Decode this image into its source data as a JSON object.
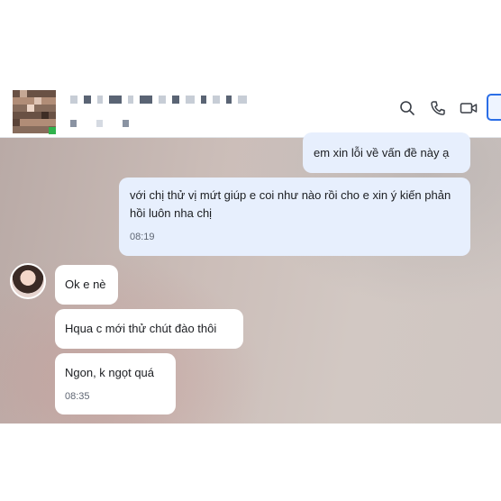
{
  "header": {
    "icons": {
      "search": "search-icon",
      "call": "phone-icon",
      "video": "video-camera-icon"
    }
  },
  "messages": {
    "m1": {
      "text": "em xin lỗi về vấn đề này ạ"
    },
    "m2": {
      "text": "với chị thử vị mứt giúp e coi như nào rồi cho e xin ý kiến phản hồi luôn nha chị",
      "time": "08:19"
    },
    "m3": {
      "text": "Ok e nè"
    },
    "m4": {
      "text": "Hqua c mới thử chút đào thôi"
    },
    "m5": {
      "text": "Ngon, k ngọt quá",
      "time": "08:35"
    }
  },
  "colors": {
    "outgoing_bubble": "#e7effd",
    "incoming_bubble": "#ffffff",
    "online": "#2fb24c",
    "accent": "#2b6ee6"
  }
}
